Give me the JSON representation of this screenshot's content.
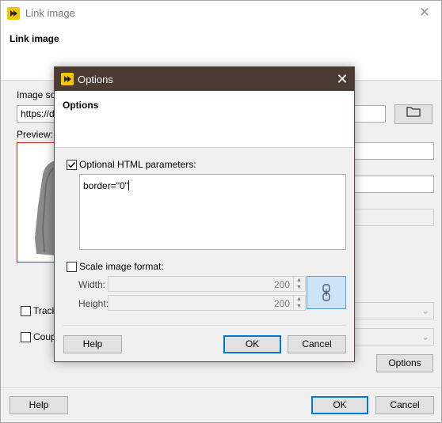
{
  "back": {
    "title": "Link image",
    "header_title": "Link image",
    "image_source_label": "Image sou",
    "url_value": "https://de",
    "preview_label": "Preview:",
    "track_label": "Track",
    "couple_label": "Coupl",
    "options_button": "Options",
    "help_button": "Help",
    "ok_button": "OK",
    "cancel_button": "Cancel"
  },
  "dialog": {
    "title": "Options",
    "header_title": "Options",
    "optional_html_label": "Optional HTML parameters:",
    "optional_html_checked": true,
    "html_params_value": "border=\"0\"",
    "scale_label": "Scale image format:",
    "scale_checked": false,
    "width_label": "Width:",
    "width_value": "200",
    "height_label": "Height:",
    "height_value": "200",
    "help_button": "Help",
    "ok_button": "OK",
    "cancel_button": "Cancel"
  },
  "icons": {
    "app": "app-logo-icon",
    "close": "close-icon",
    "folder": "folder-icon",
    "link": "link-chain-icon",
    "dropdown": "chevron-down-icon"
  },
  "colors": {
    "dialog_titlebar": "#4b3b33",
    "accent": "#0078d7",
    "app_logo": "#f5c400",
    "preview_border": "#cc2222"
  }
}
